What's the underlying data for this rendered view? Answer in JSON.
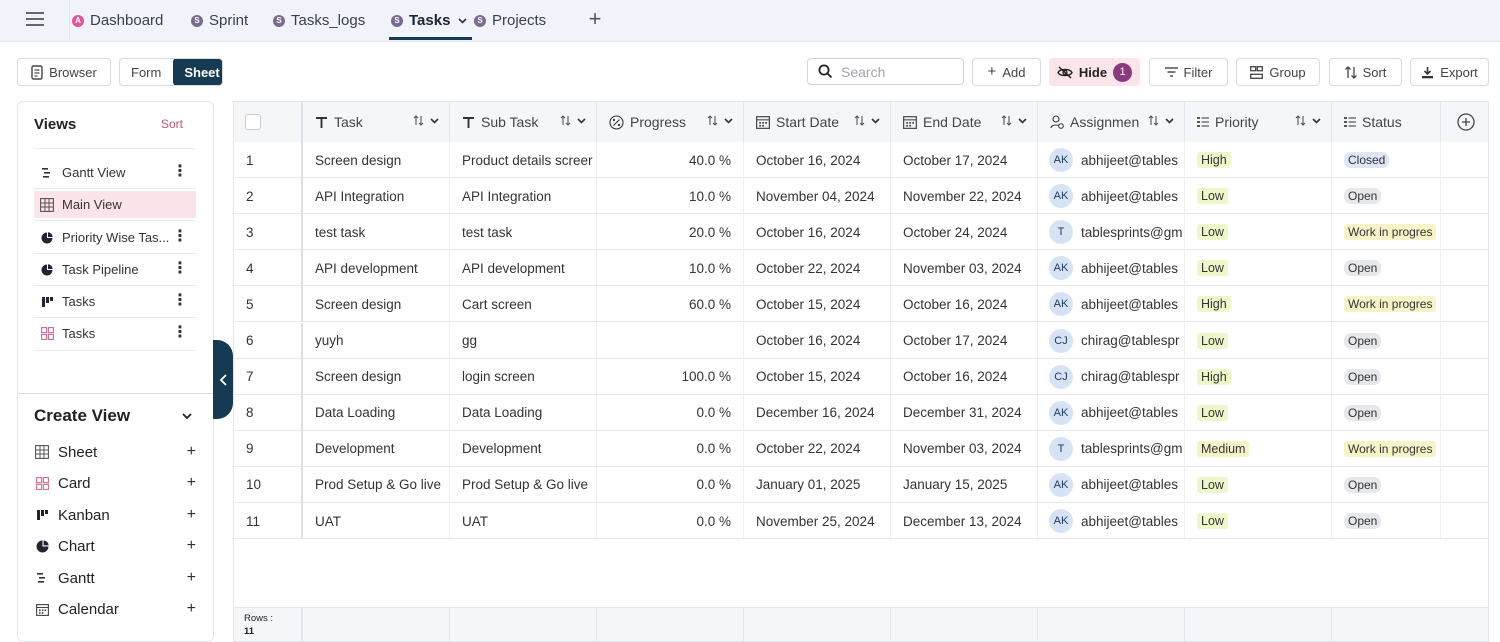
{
  "tabs": [
    {
      "badge": "A",
      "label": "Dashboard",
      "badge_color": "#e0559a"
    },
    {
      "badge": "S",
      "label": "Sprint",
      "badge_color": "#7b6a8f"
    },
    {
      "badge": "S",
      "label": "Tasks_logs",
      "badge_color": "#7b6a8f"
    },
    {
      "badge": "S",
      "label": "Tasks",
      "badge_color": "#7b6a8f",
      "active": true
    },
    {
      "badge": "S",
      "label": "Projects",
      "badge_color": "#7b6a8f"
    }
  ],
  "toolbar": {
    "browser": "Browser",
    "form": "Form",
    "sheet": "Sheet",
    "search_placeholder": "Search",
    "add": "Add",
    "hide": "Hide",
    "hide_count": "1",
    "filter": "Filter",
    "group": "Group",
    "sort": "Sort",
    "export": "Export"
  },
  "sidebar": {
    "views_title": "Views",
    "views_sort": "Sort",
    "views": [
      {
        "label": "Gantt View",
        "icon": "gantt-icon"
      },
      {
        "label": "Main View",
        "icon": "sheet-icon",
        "selected": true
      },
      {
        "label": "Priority Wise Tas...",
        "icon": "chart-icon"
      },
      {
        "label": "Task Pipeline",
        "icon": "chart-icon"
      },
      {
        "label": "Tasks",
        "icon": "kanban-icon"
      },
      {
        "label": "Tasks",
        "icon": "card-icon"
      }
    ],
    "create_title": "Create View",
    "create_items": [
      {
        "label": "Sheet",
        "icon": "sheet-icon"
      },
      {
        "label": "Card",
        "icon": "card-icon"
      },
      {
        "label": "Kanban",
        "icon": "kanban-icon"
      },
      {
        "label": "Chart",
        "icon": "chart-icon"
      },
      {
        "label": "Gantt",
        "icon": "gantt-icon"
      },
      {
        "label": "Calendar",
        "icon": "calendar-icon"
      }
    ]
  },
  "columns": [
    "Task",
    "Sub Task",
    "Progress",
    "Start Date",
    "End Date",
    "Assignmen",
    "Priority",
    "Status"
  ],
  "rows": [
    {
      "n": "1",
      "task": "Screen design",
      "sub": "Product details screer",
      "progress": "40.0 %",
      "start": "October 16, 2024",
      "end": "October 17, 2024",
      "av": "AK",
      "assignee": "abhijeet@tables",
      "priority": "High",
      "status": "Closed"
    },
    {
      "n": "2",
      "task": "API Integration",
      "sub": "API Integration",
      "progress": "10.0 %",
      "start": "November 04, 2024",
      "end": "November 22, 2024",
      "av": "AK",
      "assignee": "abhijeet@tables",
      "priority": "Low",
      "status": "Open"
    },
    {
      "n": "3",
      "task": "test task",
      "sub": "test task",
      "progress": "20.0 %",
      "start": "October 16, 2024",
      "end": "October 24, 2024",
      "av": "T",
      "assignee": "tablesprints@gm",
      "priority": "Low",
      "status": "Work in progres"
    },
    {
      "n": "4",
      "task": "API development",
      "sub": "API development",
      "progress": "10.0 %",
      "start": "October 22, 2024",
      "end": "November 03, 2024",
      "av": "AK",
      "assignee": "abhijeet@tables",
      "priority": "Low",
      "status": "Open"
    },
    {
      "n": "5",
      "task": "Screen design",
      "sub": "Cart screen",
      "progress": "60.0 %",
      "start": "October 15, 2024",
      "end": "October 16, 2024",
      "av": "AK",
      "assignee": "abhijeet@tables",
      "priority": "High",
      "status": "Work in progres"
    },
    {
      "n": "6",
      "task": "yuyh",
      "sub": "gg",
      "progress": "",
      "start": "October 16, 2024",
      "end": "October 17, 2024",
      "av": "CJ",
      "assignee": "chirag@tablespr",
      "priority": "Low",
      "status": "Open"
    },
    {
      "n": "7",
      "task": "Screen design",
      "sub": "login screen",
      "progress": "100.0 %",
      "start": "October 15, 2024",
      "end": "October 16, 2024",
      "av": "CJ",
      "assignee": "chirag@tablespr",
      "priority": "High",
      "status": "Open"
    },
    {
      "n": "8",
      "task": "Data Loading",
      "sub": "Data Loading",
      "progress": "0.0 %",
      "start": "December 16, 2024",
      "end": "December 31, 2024",
      "av": "AK",
      "assignee": "abhijeet@tables",
      "priority": "Low",
      "status": "Open"
    },
    {
      "n": "9",
      "task": "Development",
      "sub": "Development",
      "progress": "0.0 %",
      "start": "October 22, 2024",
      "end": "November 03, 2024",
      "av": "T",
      "assignee": "tablesprints@gm",
      "priority": "Medium",
      "status": "Work in progres"
    },
    {
      "n": "10",
      "task": "Prod Setup & Go live",
      "sub": "Prod Setup & Go live",
      "progress": "0.0 %",
      "start": "January 01, 2025",
      "end": "January 15, 2025",
      "av": "AK",
      "assignee": "abhijeet@tables",
      "priority": "Low",
      "status": "Open"
    },
    {
      "n": "11",
      "task": "UAT",
      "sub": "UAT",
      "progress": "0.0 %",
      "start": "November 25, 2024",
      "end": "December 13, 2024",
      "av": "AK",
      "assignee": "abhijeet@tables",
      "priority": "Low",
      "status": "Open"
    }
  ],
  "footer": {
    "rows_label": "Rows :",
    "rows_count": "11"
  },
  "colors": {
    "accent": "#163a52",
    "priority_high_bg": "#eef7c9",
    "priority_low_bg": "#eef7c9",
    "priority_medium_bg": "#f7f3c8",
    "status_closed_bg": "#dde6f7",
    "status_open_bg": "#e6e8eb",
    "status_wip_bg": "#f7f3c8",
    "selected_view_bg": "#fbe4ea"
  }
}
